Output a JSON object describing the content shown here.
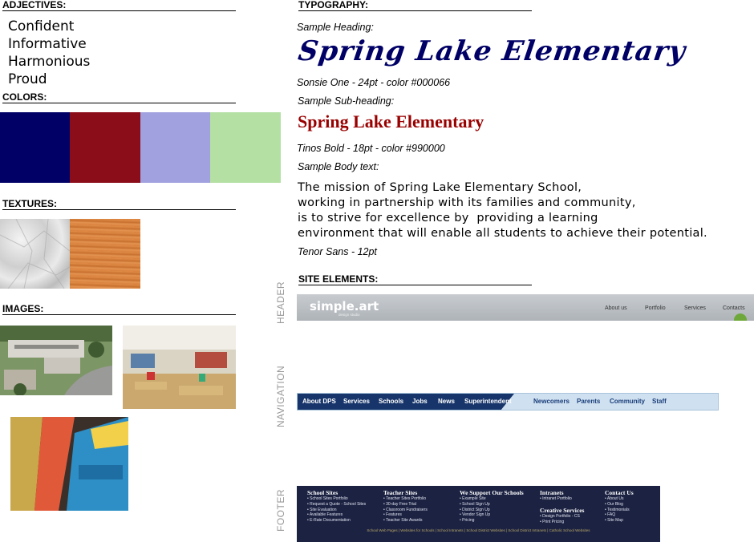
{
  "sections": {
    "adjectives": "ADJECTIVES:",
    "colors": "COLORS:",
    "textures": "TEXTURES:",
    "images": "IMAGES:",
    "typography": "TYPOGRAPHY:",
    "site_elements": "SITE ELEMENTS:"
  },
  "adjectives": [
    "Confident",
    "Informative",
    "Harmonious",
    "Proud"
  ],
  "colors": [
    "#000066",
    "#8b0d1a",
    "#a2a1df",
    "#b4e0a4"
  ],
  "typography": {
    "heading_label": "Sample Heading:",
    "heading_text": "Spring Lake Elementary",
    "heading_spec": "Sonsie One - 24pt - color #000066",
    "subheading_label": "Sample Sub-heading:",
    "subheading_text": "Spring Lake Elementary",
    "subheading_spec": "Tinos Bold - 18pt - color #990000",
    "body_label": "Sample Body text:",
    "body_lines": [
      "The mission of Spring Lake Elementary School,",
      "working in partnership with its families and community,",
      "is to strive for excellence by  providing a learning",
      "environment that will enable all students to achieve their potential."
    ],
    "body_spec": "Tenor Sans - 12pt"
  },
  "site_labels": {
    "header": "HEADER",
    "navigation": "NAVIGATION",
    "footer": "FOOTER"
  },
  "header_sample": {
    "logo": "simple.art",
    "tagline": "design studio",
    "nav": [
      "About us",
      "Portfolio",
      "Services",
      "Contacts"
    ]
  },
  "nav_sample": {
    "primary": [
      "About DPS",
      "Services",
      "Schools",
      "Jobs",
      "News",
      "Superintendent"
    ],
    "secondary": [
      "Newcomers",
      "Parents",
      "Community",
      "Staff"
    ]
  },
  "footer_sample": {
    "columns": [
      {
        "title": "School Sites",
        "items": [
          "School Sites Portfolio",
          "Request a Quote - School Sites",
          "Site Evaluation",
          "Available Features",
          "E-Rate Documentation"
        ]
      },
      {
        "title": "Teacher Sites",
        "items": [
          "Teacher Sites Portfolio",
          "30-day Free Trial",
          "Classroom Fundraisers",
          "Features",
          "Teacher Site Awards"
        ]
      },
      {
        "title": "We Support Our Schools",
        "items": [
          "Example Site",
          "School Sign Up",
          "District Sign Up",
          "Vendor Sign Up",
          "Pricing"
        ]
      },
      {
        "title": "Intranets",
        "items": [
          "Intranet Portfolio"
        ],
        "title2": "Creative Services",
        "items2": [
          "Design Portfolio - CS",
          "Print Pricing"
        ]
      },
      {
        "title": "Contact Us",
        "items": [
          "About Us",
          "Our Blog",
          "Testimonials",
          "FAQ",
          "Site Map"
        ]
      }
    ],
    "bottom": "School Web Pages | Websites for Schools | School Intranets | School District Websites | School District Intranets | Catholic School Websites"
  }
}
